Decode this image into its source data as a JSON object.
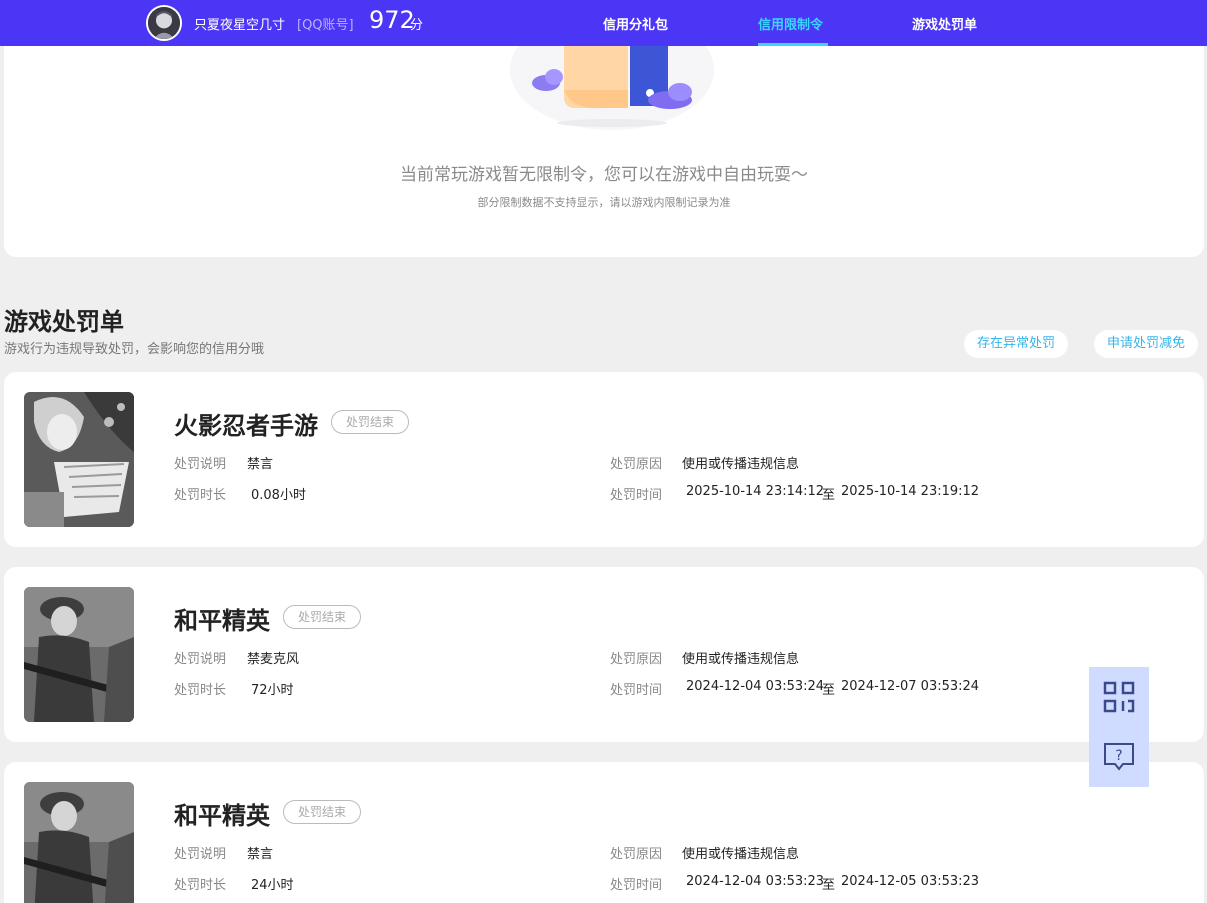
{
  "header": {
    "username": "只夏夜星空几寸",
    "account_type": "[QQ账号]",
    "score": "972",
    "score_unit": "分",
    "nav": [
      {
        "label": "信用分礼包",
        "active": false
      },
      {
        "label": "信用限制令",
        "active": true
      },
      {
        "label": "游戏处罚单",
        "active": false
      }
    ]
  },
  "restriction": {
    "message": "当前常玩游戏暂无限制令，您可以在游戏中自由玩耍～",
    "note": "部分限制数据不支持显示，请以游戏内限制记录为准"
  },
  "penalty_section": {
    "title": "游戏处罚单",
    "subtitle": "游戏行为违规导致处罚，会影响您的信用分哦",
    "btn_appeal": "存在异常处罚",
    "btn_reduce": "申请处罚减免",
    "labels": {
      "desc": "处罚说明",
      "duration": "处罚时长",
      "reason": "处罚原因",
      "time": "处罚时间"
    },
    "items": [
      {
        "game": "火影忍者手游",
        "status": "处罚结束",
        "desc": "禁言",
        "duration": "0.08小时",
        "reason": "使用或传播违规信息",
        "time_start": "2025-10-14 23:14:12",
        "time_sep": "至",
        "time_end": "2025-10-14 23:19:12"
      },
      {
        "game": "和平精英",
        "status": "处罚结束",
        "desc": "禁麦克风",
        "duration": "72小时",
        "reason": "使用或传播违规信息",
        "time_start": "2024-12-04 03:53:24",
        "time_sep": "至",
        "time_end": "2024-12-07 03:53:24"
      },
      {
        "game": "和平精英",
        "status": "处罚结束",
        "desc": "禁言",
        "duration": "24小时",
        "reason": "使用或传播违规信息",
        "time_start": "2024-12-04 03:53:23",
        "time_sep": "至",
        "time_end": "2024-12-05 03:53:23"
      }
    ]
  },
  "floating": {
    "qr_icon": "qr-code-icon",
    "help_icon": "help-chat-icon",
    "help_glyph": "?"
  },
  "colors": {
    "nav_bg": "#4b36f5",
    "nav_active": "#3bd5ff",
    "pill_text": "#36b5e8",
    "float_bg": "#cfdcff"
  }
}
